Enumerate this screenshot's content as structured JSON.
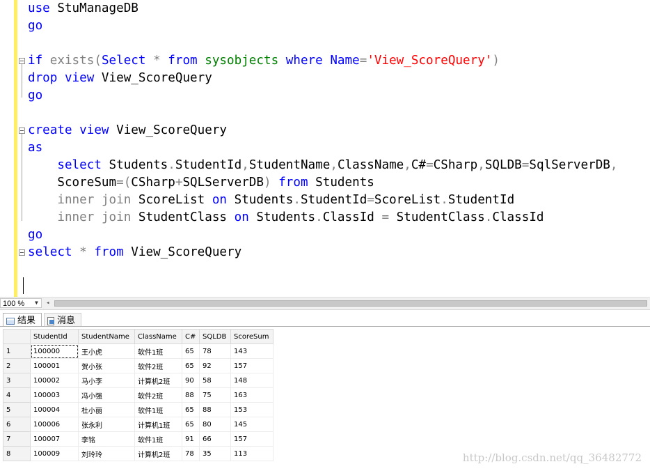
{
  "editor": {
    "lines": [
      {
        "tokens": [
          {
            "t": "use",
            "c": "kw"
          },
          {
            "t": " StuManageDB",
            "c": "tx"
          }
        ]
      },
      {
        "tokens": [
          {
            "t": "go",
            "c": "kw"
          }
        ]
      },
      {
        "tokens": []
      },
      {
        "collapse": true,
        "tokens": [
          {
            "t": "if",
            "c": "kw"
          },
          {
            "t": " ",
            "c": "tx"
          },
          {
            "t": "exists",
            "c": "gr"
          },
          {
            "t": "(",
            "c": "gr"
          },
          {
            "t": "Select",
            "c": "kw"
          },
          {
            "t": " ",
            "c": "tx"
          },
          {
            "t": "*",
            "c": "gr"
          },
          {
            "t": " ",
            "c": "tx"
          },
          {
            "t": "from",
            "c": "kw"
          },
          {
            "t": " ",
            "c": "tx"
          },
          {
            "t": "sysobjects",
            "c": "gn"
          },
          {
            "t": " ",
            "c": "tx"
          },
          {
            "t": "where",
            "c": "kw"
          },
          {
            "t": " ",
            "c": "tx"
          },
          {
            "t": "Name",
            "c": "kw"
          },
          {
            "t": "=",
            "c": "gr"
          },
          {
            "t": "'View_ScoreQuery'",
            "c": "str"
          },
          {
            "t": ")",
            "c": "gr"
          }
        ]
      },
      {
        "tokens": [
          {
            "t": "drop",
            "c": "kw"
          },
          {
            "t": " ",
            "c": "tx"
          },
          {
            "t": "view",
            "c": "kw"
          },
          {
            "t": " View_ScoreQuery",
            "c": "tx"
          }
        ]
      },
      {
        "tokens": [
          {
            "t": "go",
            "c": "kw"
          }
        ]
      },
      {
        "tokens": []
      },
      {
        "collapse": true,
        "tokens": [
          {
            "t": "create",
            "c": "kw"
          },
          {
            "t": " ",
            "c": "tx"
          },
          {
            "t": "view",
            "c": "kw"
          },
          {
            "t": " View_ScoreQuery",
            "c": "tx"
          }
        ]
      },
      {
        "tokens": [
          {
            "t": "as",
            "c": "kw"
          }
        ]
      },
      {
        "tokens": [
          {
            "t": "    ",
            "c": "tx"
          },
          {
            "t": "select",
            "c": "kw"
          },
          {
            "t": " Students",
            "c": "tx"
          },
          {
            "t": ".",
            "c": "gr"
          },
          {
            "t": "StudentId",
            "c": "tx"
          },
          {
            "t": ",",
            "c": "gr"
          },
          {
            "t": "StudentName",
            "c": "tx"
          },
          {
            "t": ",",
            "c": "gr"
          },
          {
            "t": "ClassName",
            "c": "tx"
          },
          {
            "t": ",",
            "c": "gr"
          },
          {
            "t": "C#",
            "c": "tx"
          },
          {
            "t": "=",
            "c": "gr"
          },
          {
            "t": "CSharp",
            "c": "tx"
          },
          {
            "t": ",",
            "c": "gr"
          },
          {
            "t": "SQLDB",
            "c": "tx"
          },
          {
            "t": "=",
            "c": "gr"
          },
          {
            "t": "SqlServerDB",
            "c": "tx"
          },
          {
            "t": ",",
            "c": "gr"
          }
        ]
      },
      {
        "tokens": [
          {
            "t": "    ScoreSum",
            "c": "tx"
          },
          {
            "t": "=(",
            "c": "gr"
          },
          {
            "t": "CSharp",
            "c": "tx"
          },
          {
            "t": "+",
            "c": "gr"
          },
          {
            "t": "SQLServerDB",
            "c": "tx"
          },
          {
            "t": ")",
            "c": "gr"
          },
          {
            "t": " ",
            "c": "tx"
          },
          {
            "t": "from",
            "c": "kw"
          },
          {
            "t": " Students",
            "c": "tx"
          }
        ]
      },
      {
        "tokens": [
          {
            "t": "    ",
            "c": "tx"
          },
          {
            "t": "inner",
            "c": "gr"
          },
          {
            "t": " ",
            "c": "tx"
          },
          {
            "t": "join",
            "c": "gr"
          },
          {
            "t": " ScoreList ",
            "c": "tx"
          },
          {
            "t": "on",
            "c": "kw"
          },
          {
            "t": " Students",
            "c": "tx"
          },
          {
            "t": ".",
            "c": "gr"
          },
          {
            "t": "StudentId",
            "c": "tx"
          },
          {
            "t": "=",
            "c": "gr"
          },
          {
            "t": "ScoreList",
            "c": "tx"
          },
          {
            "t": ".",
            "c": "gr"
          },
          {
            "t": "StudentId",
            "c": "tx"
          }
        ]
      },
      {
        "tokens": [
          {
            "t": "    ",
            "c": "tx"
          },
          {
            "t": "inner",
            "c": "gr"
          },
          {
            "t": " ",
            "c": "tx"
          },
          {
            "t": "join",
            "c": "gr"
          },
          {
            "t": " StudentClass ",
            "c": "tx"
          },
          {
            "t": "on",
            "c": "kw"
          },
          {
            "t": " Students",
            "c": "tx"
          },
          {
            "t": ".",
            "c": "gr"
          },
          {
            "t": "ClassId ",
            "c": "tx"
          },
          {
            "t": "=",
            "c": "gr"
          },
          {
            "t": " StudentClass",
            "c": "tx"
          },
          {
            "t": ".",
            "c": "gr"
          },
          {
            "t": "ClassId",
            "c": "tx"
          }
        ]
      },
      {
        "tokens": [
          {
            "t": "go",
            "c": "kw"
          }
        ]
      },
      {
        "collapse": true,
        "tokens": [
          {
            "t": "select",
            "c": "kw"
          },
          {
            "t": " ",
            "c": "tx"
          },
          {
            "t": "*",
            "c": "gr"
          },
          {
            "t": " ",
            "c": "tx"
          },
          {
            "t": "from",
            "c": "kw"
          },
          {
            "t": " View_ScoreQuery",
            "c": "tx"
          }
        ]
      }
    ]
  },
  "toolbar": {
    "zoom": "100 %"
  },
  "tabs": {
    "results": "结果",
    "messages": "消息"
  },
  "grid": {
    "columns": [
      "StudentId",
      "StudentName",
      "ClassName",
      "C#",
      "SQLDB",
      "ScoreSum"
    ],
    "rows": [
      [
        "1",
        "100000",
        "王小虎",
        "软件1班",
        "65",
        "78",
        "143"
      ],
      [
        "2",
        "100001",
        "贺小张",
        "软件2班",
        "65",
        "92",
        "157"
      ],
      [
        "3",
        "100002",
        "马小李",
        "计算机2班",
        "90",
        "58",
        "148"
      ],
      [
        "4",
        "100003",
        "冯小强",
        "软件2班",
        "88",
        "75",
        "163"
      ],
      [
        "5",
        "100004",
        "杜小丽",
        "软件1班",
        "65",
        "88",
        "153"
      ],
      [
        "6",
        "100006",
        "张永利",
        "计算机1班",
        "65",
        "80",
        "145"
      ],
      [
        "7",
        "100007",
        "李铭",
        "软件1班",
        "91",
        "66",
        "157"
      ],
      [
        "8",
        "100009",
        "刘玲玲",
        "计算机2班",
        "78",
        "35",
        "113"
      ]
    ]
  },
  "watermark": "http://blog.csdn.net/qq_36482772"
}
